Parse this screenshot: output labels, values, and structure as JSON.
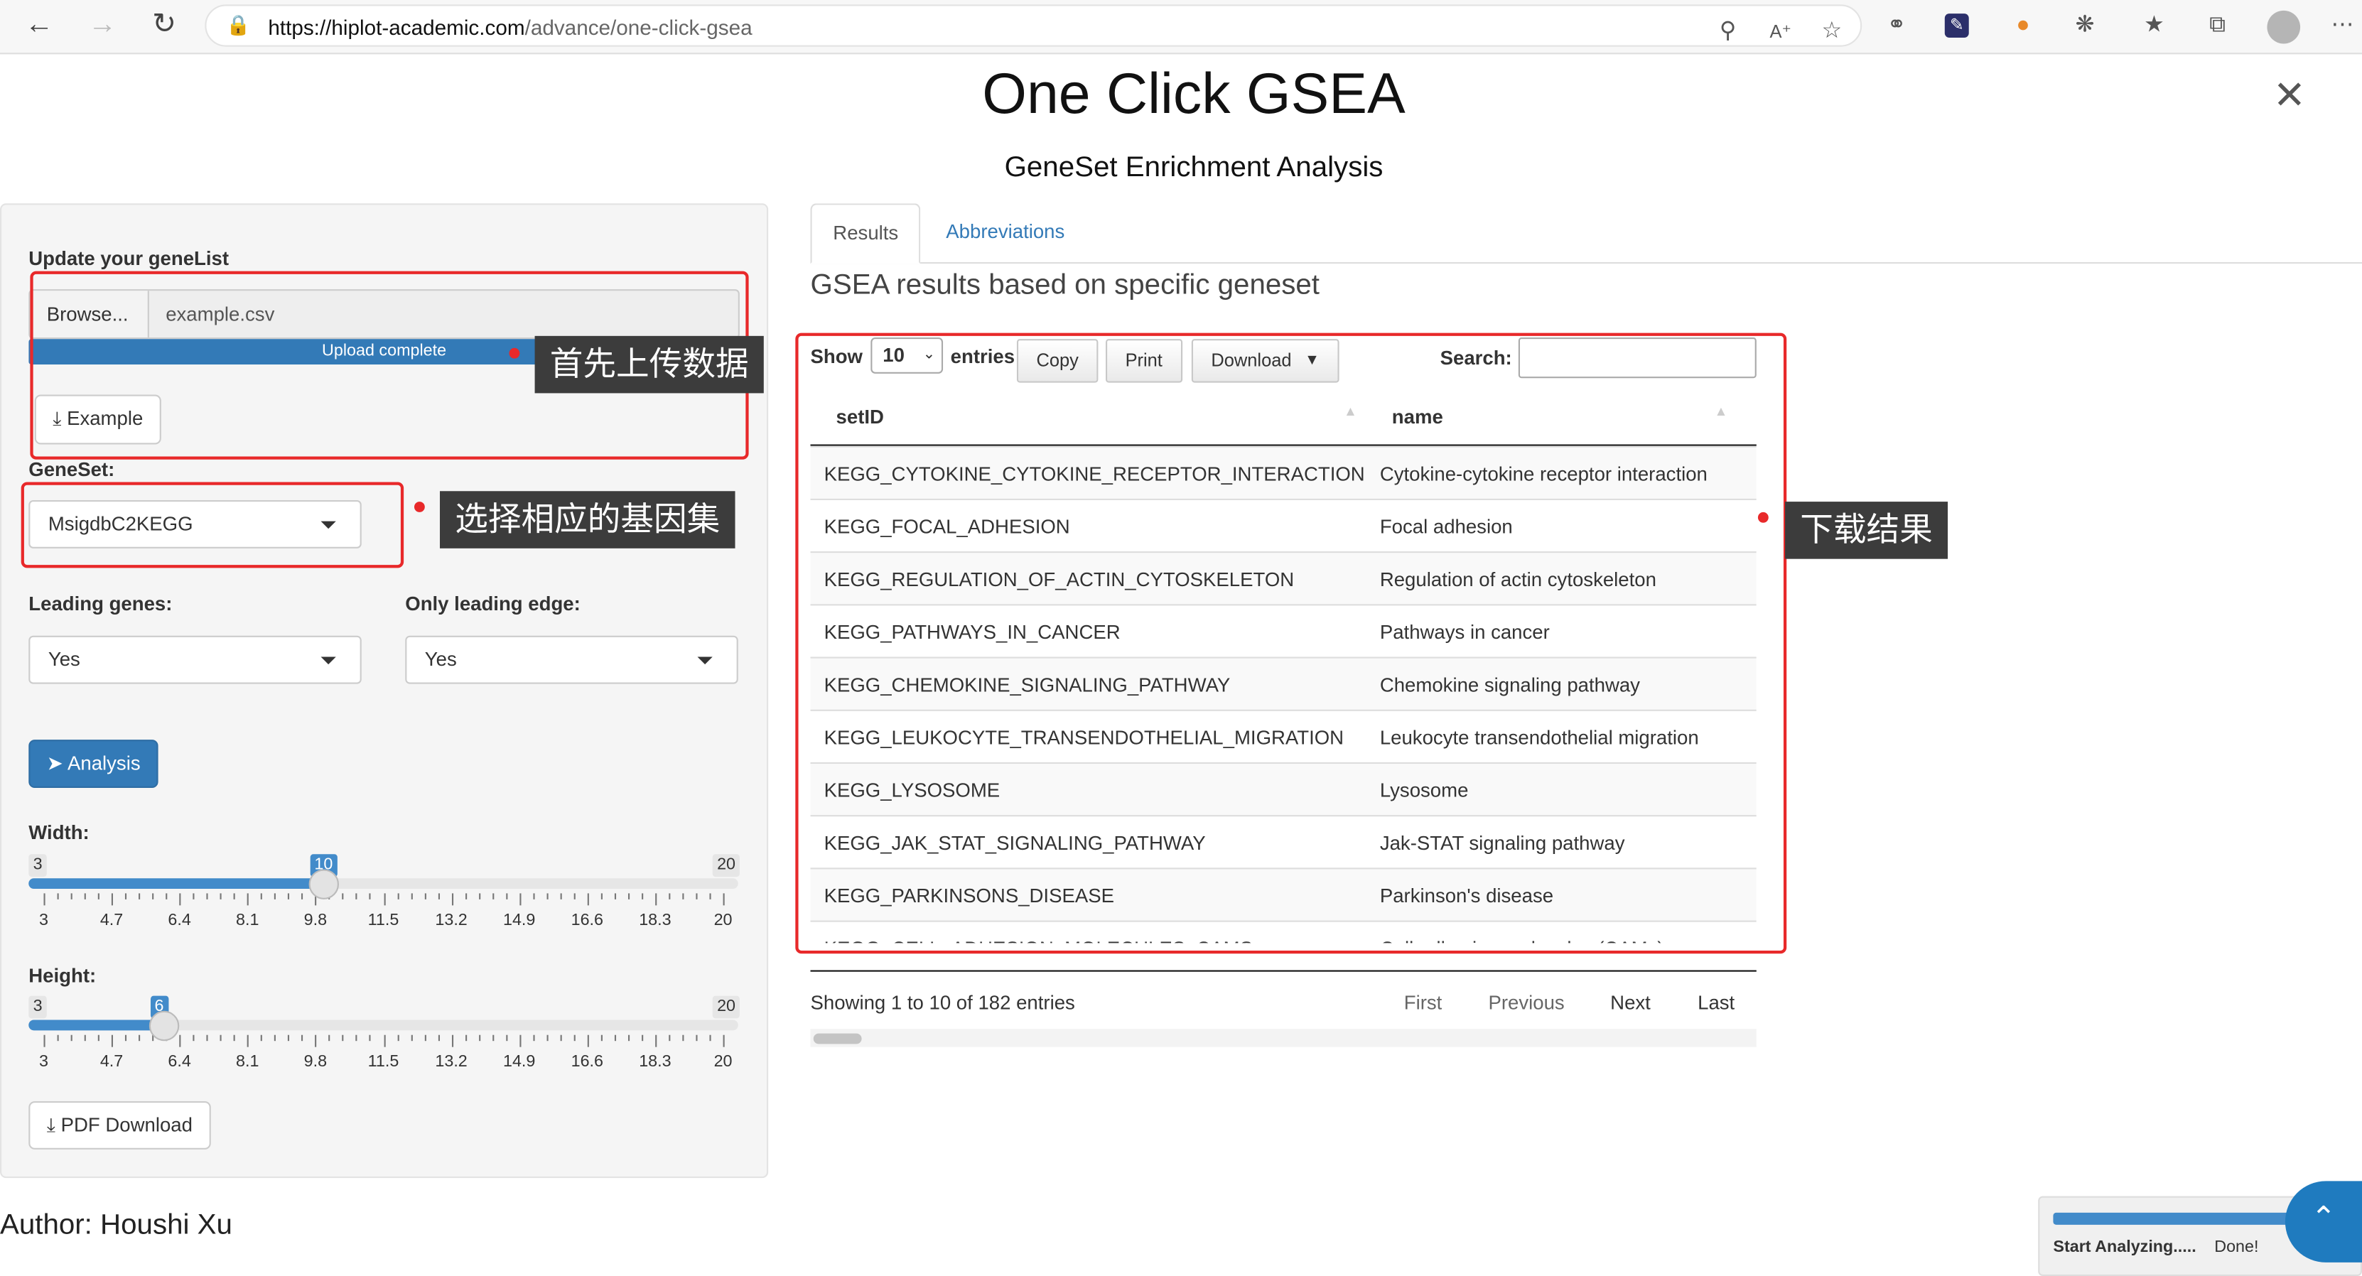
{
  "browser": {
    "url_host": "https://hiplot-academic.com",
    "url_path": "/advance/one-click-gsea"
  },
  "header": {
    "title": "One Click GSEA",
    "subtitle": "GeneSet Enrichment Analysis"
  },
  "sidebar": {
    "genelist_label": "Update your geneList",
    "browse_label": "Browse...",
    "file_name": "example.csv",
    "upload_status": "Upload complete",
    "upload_progress_pct": 100,
    "example_label": "Example",
    "geneset_label": "GeneSet:",
    "geneset_value": "MsigdbC2KEGG",
    "leading_label": "Leading genes:",
    "leading_value": "Yes",
    "edge_label": "Only leading edge:",
    "edge_value": "Yes",
    "analysis_label": "Analysis",
    "width": {
      "label": "Width:",
      "min": "3",
      "max": "20",
      "value": "10",
      "ticks": [
        "3",
        "4.7",
        "6.4",
        "8.1",
        "9.8",
        "11.5",
        "13.2",
        "14.9",
        "16.6",
        "18.3",
        "20"
      ]
    },
    "height": {
      "label": "Height:",
      "min": "3",
      "max": "20",
      "value": "6",
      "ticks": [
        "3",
        "4.7",
        "6.4",
        "8.1",
        "9.8",
        "11.5",
        "13.2",
        "14.9",
        "16.6",
        "18.3",
        "20"
      ]
    },
    "pdf_label": "PDF Download"
  },
  "annotations": {
    "upload": "首先上传数据",
    "geneset": "选择相应的基因集",
    "download": "下载结果"
  },
  "tabs": [
    "Results",
    "Abbreviations"
  ],
  "results": {
    "heading": "GSEA results based on specific geneset",
    "show_label": "Show",
    "entries_label": "entries",
    "length_value": "10",
    "copy": "Copy",
    "print": "Print",
    "download": "Download",
    "search_label": "Search:",
    "columns": [
      "setID",
      "name"
    ],
    "rows": [
      [
        "KEGG_CYTOKINE_CYTOKINE_RECEPTOR_INTERACTION",
        "Cytokine-cytokine receptor interaction"
      ],
      [
        "KEGG_FOCAL_ADHESION",
        "Focal adhesion"
      ],
      [
        "KEGG_REGULATION_OF_ACTIN_CYTOSKELETON",
        "Regulation of actin cytoskeleton"
      ],
      [
        "KEGG_PATHWAYS_IN_CANCER",
        "Pathways in cancer"
      ],
      [
        "KEGG_CHEMOKINE_SIGNALING_PATHWAY",
        "Chemokine signaling pathway"
      ],
      [
        "KEGG_LEUKOCYTE_TRANSENDOTHELIAL_MIGRATION",
        "Leukocyte transendothelial migration"
      ],
      [
        "KEGG_LYSOSOME",
        "Lysosome"
      ],
      [
        "KEGG_JAK_STAT_SIGNALING_PATHWAY",
        "Jak-STAT signaling pathway"
      ],
      [
        "KEGG_PARKINSONS_DISEASE",
        "Parkinson's disease"
      ],
      [
        "KEGG_CELL_ADHESION_MOLECULES_CAMS",
        "Cell adhesion molecules (CAMs)"
      ]
    ],
    "info": "Showing 1 to 10 of 182 entries",
    "paging": [
      "First",
      "Previous",
      "Next",
      "Last"
    ]
  },
  "footer": {
    "author": "Author: Houshi Xu"
  },
  "toast": {
    "label": "Start Analyzing.....",
    "status": "Done!"
  },
  "colors": {
    "accent": "#428bca",
    "annotation_red": "#e8292a",
    "note_bg": "#3c3c3c",
    "fab": "#1f7bbf"
  }
}
